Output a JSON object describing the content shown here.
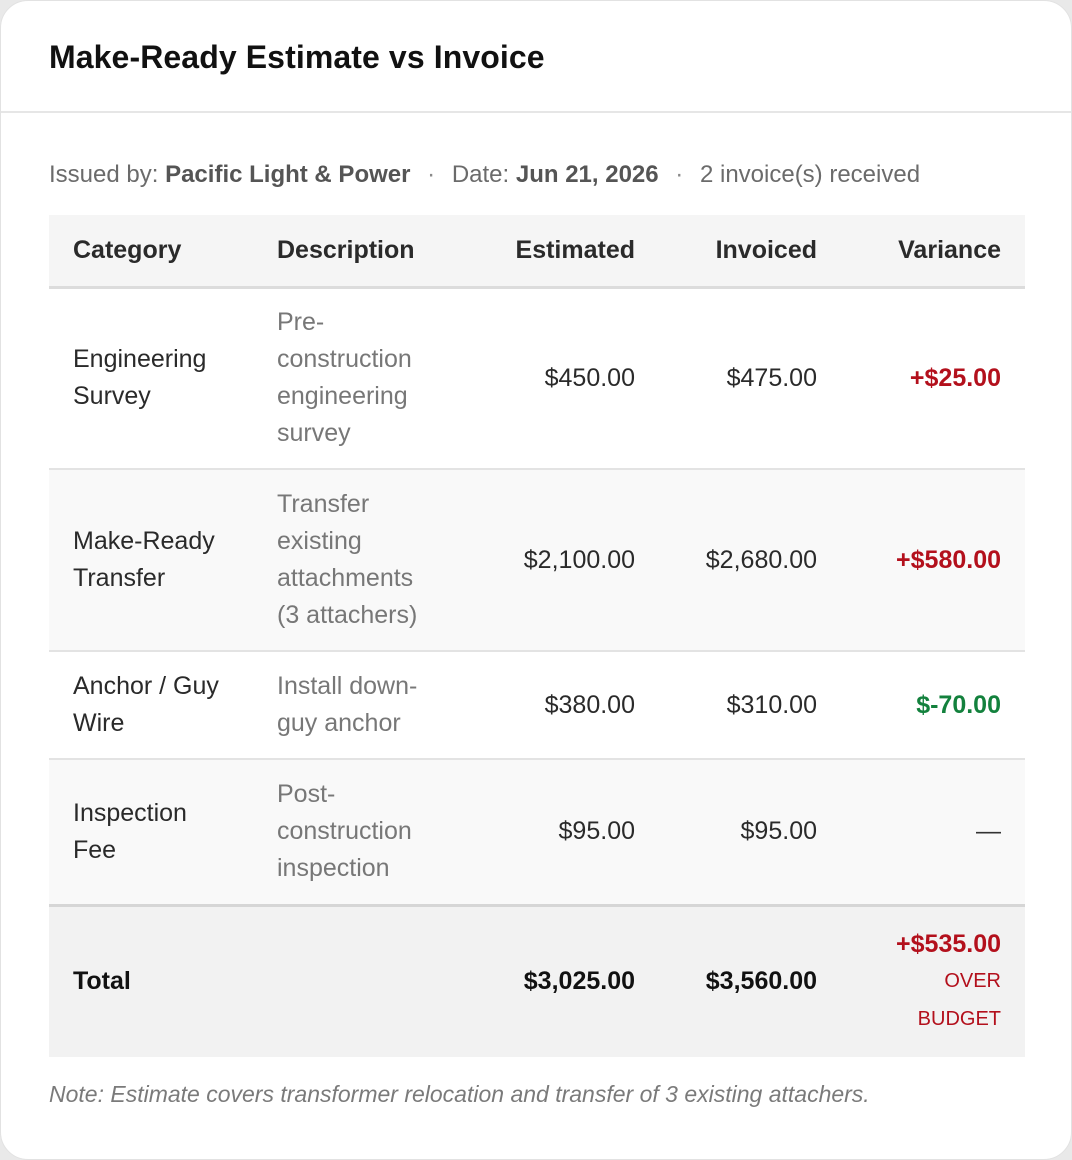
{
  "title": "Make-Ready Estimate vs Invoice",
  "meta": {
    "issued_label": "Issued by:",
    "issuer": "Pacific Light & Power",
    "separator": "·",
    "date_label": "Date:",
    "date": "Jun 21, 2026",
    "invoices": "2 invoice(s) received"
  },
  "table": {
    "headers": [
      "Category",
      "Description",
      "Estimated",
      "Invoiced",
      "Variance"
    ],
    "rows": [
      {
        "category": "Engineering Survey",
        "description": "Pre-construction engineering survey",
        "estimated": "$450.00",
        "invoiced": "$475.00",
        "variance": "+$25.00",
        "variance_status": "over"
      },
      {
        "category": "Make-Ready Transfer",
        "description": "Transfer existing attachments (3 attachers)",
        "estimated": "$2,100.00",
        "invoiced": "$2,680.00",
        "variance": "+$580.00",
        "variance_status": "over"
      },
      {
        "category": "Anchor / Guy Wire",
        "description": "Install down-guy anchor",
        "estimated": "$380.00",
        "invoiced": "$310.00",
        "variance": "$-70.00",
        "variance_status": "under"
      },
      {
        "category": "Inspection Fee",
        "description": "Post-construction inspection",
        "estimated": "$95.00",
        "invoiced": "$95.00",
        "variance": "—",
        "variance_status": "none"
      }
    ],
    "total": {
      "label": "Total",
      "estimated": "$3,025.00",
      "invoiced": "$3,560.00",
      "variance": "+$535.00",
      "status": "OVER BUDGET"
    }
  },
  "note": "Note: Estimate covers transformer relocation and transfer of 3 existing attachers.",
  "colors": {
    "over": "#b3101c",
    "under": "#13813d"
  }
}
